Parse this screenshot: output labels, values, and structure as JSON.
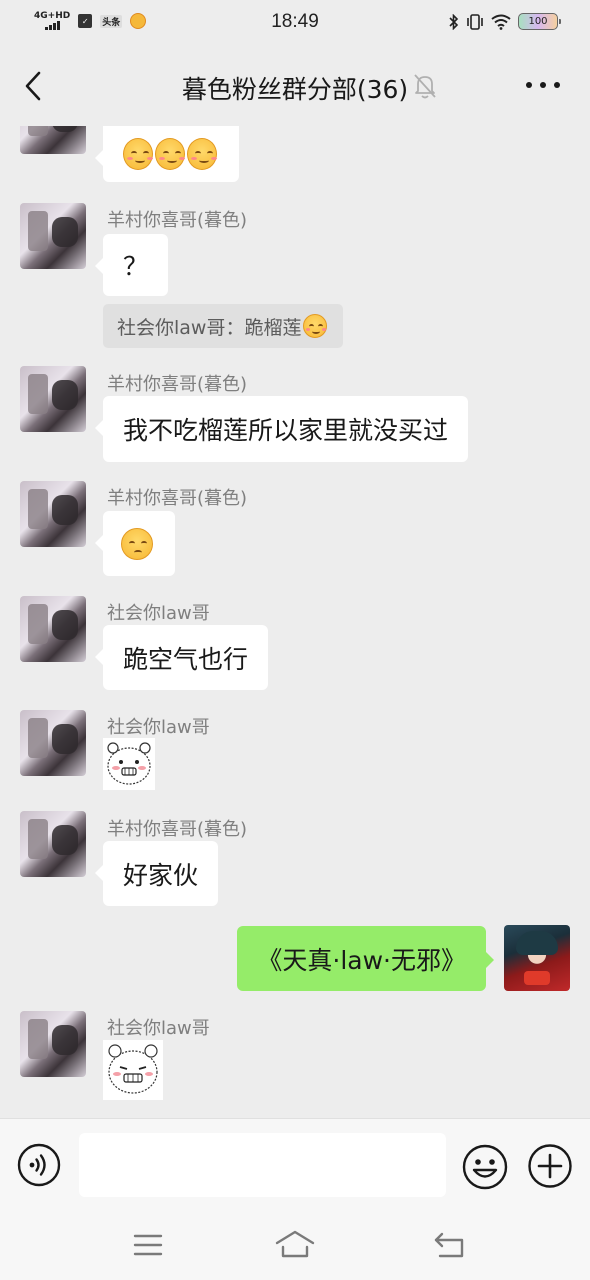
{
  "status_bar": {
    "network": "4G+HD",
    "news_tag": "头条",
    "time": "18:49",
    "battery": "100"
  },
  "header": {
    "title": "暮色粉丝群分部(36)"
  },
  "messages": [
    {
      "sender": "",
      "type": "emoji-bubble",
      "content": "🥰🥰🥰"
    },
    {
      "sender": "羊村你喜哥(暮色)",
      "type": "text",
      "content": "？"
    },
    {
      "type": "quote",
      "content": "社会你law哥：跪榴莲"
    },
    {
      "sender": "羊村你喜哥(暮色)",
      "type": "text",
      "content": "我不吃榴莲所以家里就没买过"
    },
    {
      "sender": "羊村你喜哥(暮色)",
      "type": "emoji-bubble",
      "content": "🥺"
    },
    {
      "sender": "社会你law哥",
      "type": "text",
      "content": "跪空气也行"
    },
    {
      "sender": "社会你law哥",
      "type": "sticker",
      "content": ""
    },
    {
      "sender": "羊村你喜哥(暮色)",
      "type": "text",
      "content": "好家伙"
    },
    {
      "sender": "",
      "type": "text-me",
      "content": "《天真·law·无邪》"
    },
    {
      "sender": "社会你law哥",
      "type": "sticker",
      "content": ""
    }
  ],
  "input": {
    "value": "",
    "placeholder": ""
  },
  "colors": {
    "background": "#ededed",
    "bubble_left": "#ffffff",
    "bubble_me": "#95ec69",
    "sender_name": "#7f7f7f"
  },
  "icons": {
    "back": "chevron-left-icon",
    "mute": "bell-off-icon",
    "more": "more-dots-icon",
    "voice": "voice-icon",
    "emoji": "smiley-icon",
    "plus": "plus-circle-icon",
    "menu": "menu-icon",
    "home": "home-icon",
    "return": "return-icon"
  }
}
